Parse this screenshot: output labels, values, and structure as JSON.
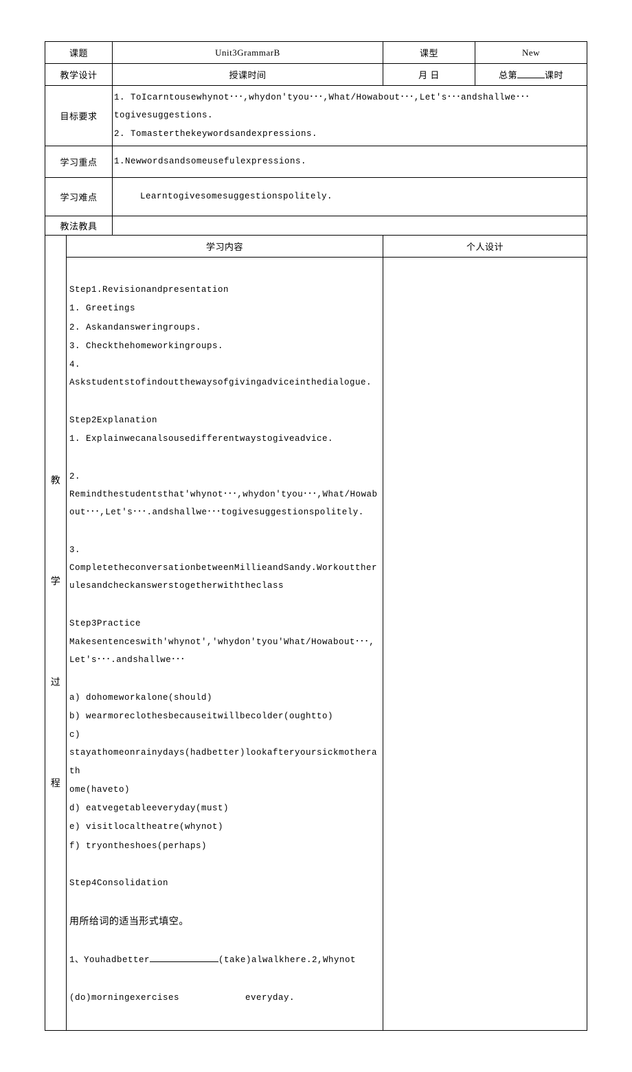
{
  "header": {
    "topic_label": "课题",
    "topic_value": "Unit3GrammarB",
    "type_label": "课型",
    "type_value": "New",
    "design_label": "教学设计",
    "time_label": "授课时间",
    "date_value": "月 日",
    "total_prefix": "总第",
    "total_suffix": "课时"
  },
  "goals": {
    "label": "目标要求",
    "line1": "1.  ToIcarntousewhynot･･･,whydon'tyou･･･,What/Howabout･･･,Let's･･･andshallwe･･･togivesuggestions.",
    "line2": "2.  Tomasterthekeywordsandexpressions."
  },
  "focus": {
    "label": "学习重点",
    "text": "1.Newwordsandsomeusefulexpressions."
  },
  "difficulty": {
    "label": "学习难点",
    "text": "Learntogivesomesuggestionspolitely."
  },
  "tools": {
    "label": "教法教具"
  },
  "process": {
    "side_label": "教\n\n学\n\n过\n\n程",
    "col1_header": "学习内容",
    "col2_header": "个人设计",
    "lines": [
      "",
      "Step1.Revisionandpresentation",
      "1.    Greetings",
      "2.    Askandansweringroups.",
      "3.    Checkthehomeworkingroups.",
      "4.    Askstudentstofindoutthewaysofgivingadviceinthedialogue.",
      "",
      "Step2Explanation",
      "1. Explainwecanalsousedifferentwaystogiveadvice.",
      "",
      "2. Remindthestudentsthat'whynot･･･,whydon'tyou･･･,What/Howabout･･･,Let's･･･.andshallwe･･･togivesuggestionspolitely.",
      "",
      "3. CompletetheconversationbetweenMillieandSandy.Workouttherulesandcheckanswerstogetherwiththeclass",
      "",
      "Step3Practice",
      "Makesentenceswith'whynot','whydon'tyou'What/Howabout･･･,Let's･･･.andshallwe･･･",
      "",
      "a)  dohomeworkalone(should)",
      "b)  wearmoreclothesbecauseitwillbecolder(oughtto)",
      "c)  stayathomeonrainydays(hadbetter)lookafteryoursickmotherathome(haveto)",
      "d)  eatvegetableeveryday(must)",
      "e)  visitlocaltheatre(whynot)",
      "f)  tryontheshoes(perhaps)",
      "",
      "Step4Consolidation",
      ""
    ],
    "fill_title": "用所给词的适当形式填空。",
    "fill_line1_a": "1、Youhadbetter",
    "fill_line1_b": "(take)alwalkhere.2,Whynot",
    "fill_line2_a": "(do)morningexercises",
    "fill_line2_b": "everyday."
  }
}
